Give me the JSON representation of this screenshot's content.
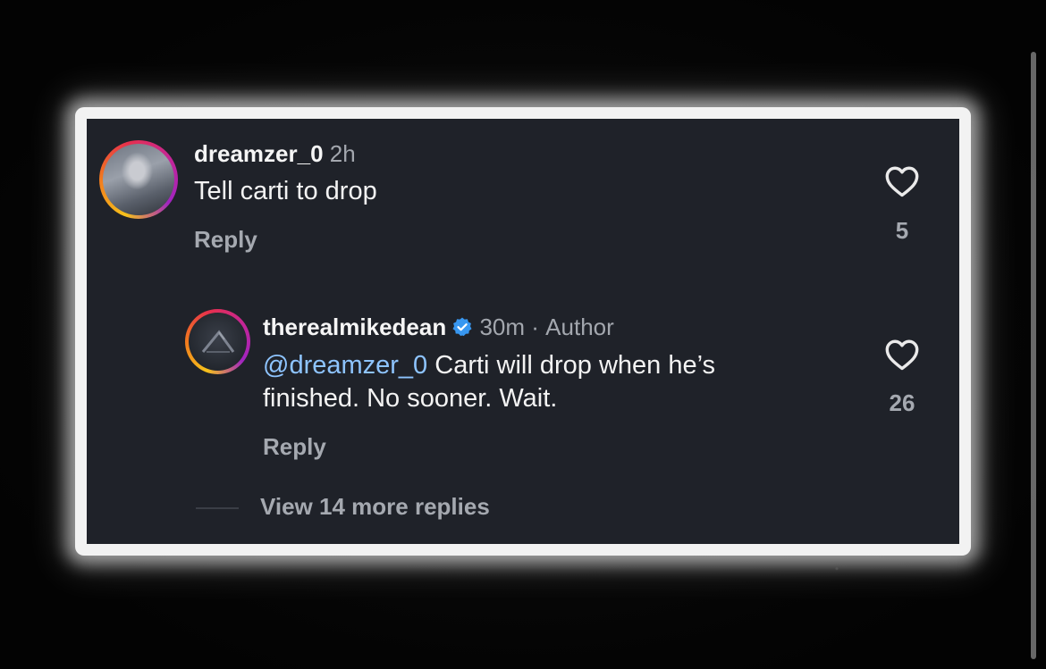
{
  "comments": [
    {
      "username": "dreamzer_0",
      "time": "2h",
      "text": "Tell carti to drop",
      "reply_label": "Reply",
      "likes": "5",
      "avatar_icon": "user-avatar-icon"
    }
  ],
  "reply": {
    "username": "therealmikedean",
    "verified": true,
    "time": "30m",
    "separator": "·",
    "author_label": "Author",
    "mention": "@dreamzer_0",
    "text_line1": "Carti will drop when he’s",
    "text_line2": "finished. No sooner.  Wait.",
    "reply_label": "Reply",
    "likes": "26",
    "avatar_icon": "user-avatar-icon"
  },
  "view_more_label": "View 14 more replies",
  "icons": {
    "like": "heart-outline-icon",
    "verified": "verified-badge-icon"
  },
  "colors": {
    "card_background": "#1f2229",
    "mention": "#8ec4ff",
    "verified": "#3897f0",
    "muted_text": "#a5a9b0",
    "story_ring_start": "#f6c21b",
    "story_ring_end": "#c52597"
  }
}
